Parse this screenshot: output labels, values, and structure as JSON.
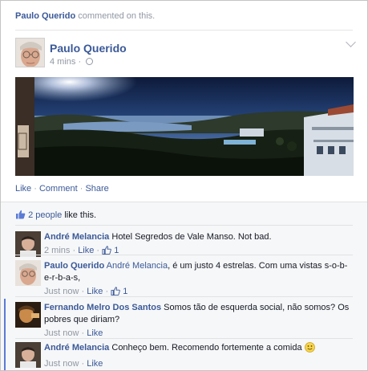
{
  "story": {
    "context_name": "Paulo Querido",
    "context_text": " commented on this.",
    "author": "Paulo Querido",
    "time": "4 mins · "
  },
  "actions": {
    "like": "Like",
    "comment": "Comment",
    "share": "Share",
    "dot": " · "
  },
  "likes": {
    "count_link": "2 people",
    "suffix": " like this."
  },
  "comments": [
    {
      "name": "André Melancia",
      "text": " Hotel Segredos de Vale Manso. Not bad.",
      "time": "2 mins",
      "like": "Like",
      "like_count": "1"
    },
    {
      "name": "Paulo Querido",
      "mention": "André Melancia",
      "text": ", é um justo 4 estrelas. Com uma vistas s-o-b-e-r-b-a-s,",
      "time": "Just now",
      "like": "Like",
      "like_count": "1"
    },
    {
      "name": "Fernando Melro Dos Santos",
      "text": " Somos tão de esquerda social, não somos? Os pobres que diriam?",
      "time": "Just now",
      "like": "Like"
    },
    {
      "name": "André Melancia",
      "text": " Conheço bem. Recomendo fortemente a comida ",
      "time": "Just now",
      "like": "Like"
    }
  ],
  "colors": {
    "link": "#3b5998",
    "muted": "#9197a3",
    "ufi_bg": "#f6f7f8",
    "new_bar": "#5b7bd5"
  },
  "icons": [
    "globe-icon",
    "chevron-down-icon",
    "thumbs-up-icon",
    "smiley-icon"
  ]
}
